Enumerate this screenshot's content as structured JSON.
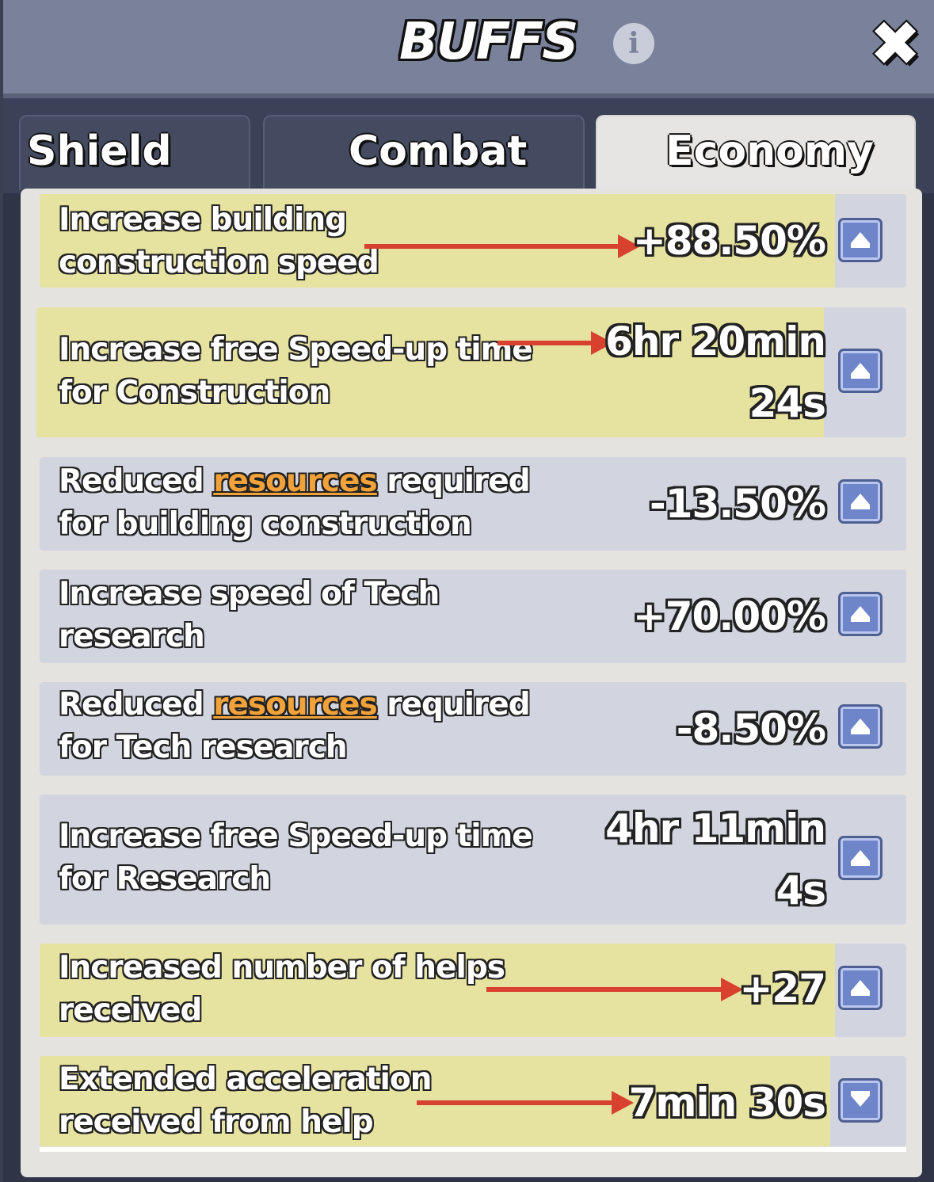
{
  "header": {
    "title": "BUFFS",
    "info_icon": "info-icon",
    "close_icon": "close-icon"
  },
  "tabs": [
    {
      "label": "Shield",
      "active": false
    },
    {
      "label": "Combat",
      "active": false
    },
    {
      "label": "Economy",
      "active": true
    }
  ],
  "colors": {
    "highlight": "#e6e29f",
    "row": "#d2d4e0",
    "link": "#f2a23a",
    "arrow": "#d8412e",
    "button": "#6e85c9"
  },
  "buffs": [
    {
      "line1": "Increase building",
      "line2": "construction speed",
      "value": "+88.50%",
      "highlighted": true,
      "expanded": false
    },
    {
      "line1": "Increase free Speed-up time",
      "line2": "for Construction",
      "value_line1": "6hr 20min",
      "value_line2": "24s",
      "highlighted": true,
      "expanded": false
    },
    {
      "line1_pre": "Reduced ",
      "line1_link": "resources",
      "line1_post": " required",
      "line2": "for building construction",
      "value": "-13.50%",
      "highlighted": false,
      "expanded": false
    },
    {
      "line1": "Increase speed of Tech",
      "line2": "research",
      "value": "+70.00%",
      "highlighted": false,
      "expanded": false
    },
    {
      "line1_pre": "Reduced ",
      "line1_link": "resources",
      "line1_post": " required",
      "line2": "for Tech research",
      "value": "-8.50%",
      "highlighted": false,
      "expanded": false
    },
    {
      "line1": "Increase free Speed-up time",
      "line2": "for Research",
      "value_line1": "4hr 11min",
      "value_line2": "4s",
      "highlighted": false,
      "expanded": false
    },
    {
      "line1": "Increased number of helps",
      "line2": "received",
      "value": "+27",
      "highlighted": true,
      "expanded": false
    },
    {
      "line1": "Extended acceleration",
      "line2": "received from help",
      "value": "7min 30s",
      "highlighted": true,
      "expanded": true
    }
  ]
}
